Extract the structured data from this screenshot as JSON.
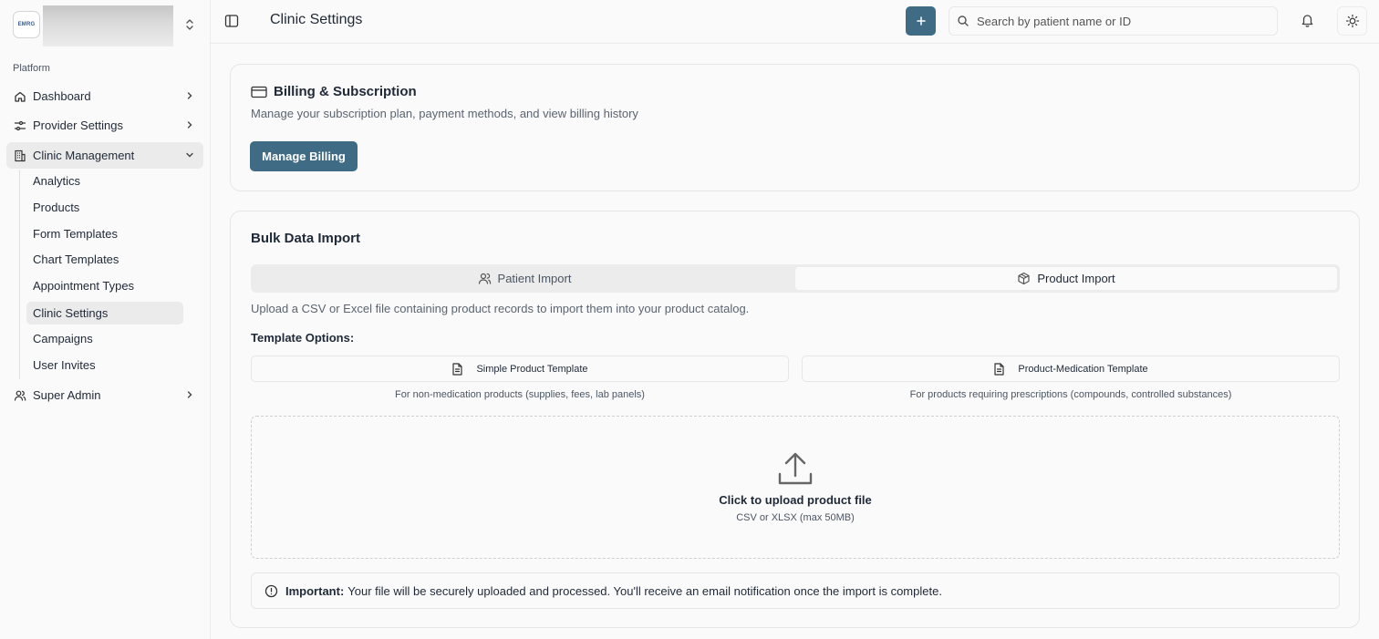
{
  "sidebar": {
    "org_logo_text": "EMRG",
    "section_label": "Platform",
    "items": [
      {
        "label": "Dashboard",
        "icon": "home-icon"
      },
      {
        "label": "Provider Settings",
        "icon": "sliders-icon"
      },
      {
        "label": "Clinic Management",
        "icon": "building-icon"
      },
      {
        "label": "Super Admin",
        "icon": "users-icon"
      }
    ],
    "clinic_management_items": [
      {
        "label": "Analytics"
      },
      {
        "label": "Products"
      },
      {
        "label": "Form Templates"
      },
      {
        "label": "Chart Templates"
      },
      {
        "label": "Appointment Types"
      },
      {
        "label": "Clinic Settings"
      },
      {
        "label": "Campaigns"
      },
      {
        "label": "User Invites"
      }
    ]
  },
  "header": {
    "title": "Clinic Settings",
    "search_placeholder": "Search by patient name or ID"
  },
  "billing": {
    "title": "Billing & Subscription",
    "description": "Manage your subscription plan, payment methods, and view billing history",
    "button_label": "Manage Billing"
  },
  "bulk_import": {
    "title": "Bulk Data Import",
    "tabs": [
      {
        "label": "Patient Import",
        "selected": false
      },
      {
        "label": "Product Import",
        "selected": true
      }
    ],
    "description": "Upload a CSV or Excel file containing product records to import them into your product catalog.",
    "template_options_label": "Template Options:",
    "templates": [
      {
        "label": "Simple Product Template",
        "description": "For non-medication products (supplies, fees, lab panels)"
      },
      {
        "label": "Product-Medication Template",
        "description": "For products requiring prescriptions (compounds, controlled substances)"
      }
    ],
    "dropzone": {
      "title": "Click to upload product file",
      "subtitle": "CSV or XLSX (max 50MB)"
    },
    "notice": {
      "strong": "Important:",
      "text": "Your file will be securely uploaded and processed. You'll receive an email notification once the import is complete."
    }
  },
  "colors": {
    "primary": "#3f6b85",
    "background": "#fafafa",
    "border": "#e6e6e6"
  }
}
